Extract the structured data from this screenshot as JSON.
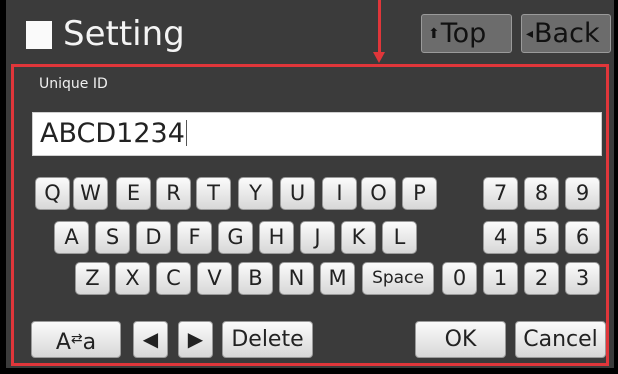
{
  "header": {
    "title": "Setting",
    "top_label": "Top",
    "top_icon": "⬆",
    "back_label": "Back",
    "back_icon": "◂"
  },
  "form": {
    "unique_id_label": "Unique ID",
    "unique_id_value": "ABCD1234"
  },
  "keyboard": {
    "letters_row1": [
      "Q",
      "W",
      "E",
      "R",
      "T",
      "Y",
      "U",
      "I",
      "O",
      "P"
    ],
    "letters_row2": [
      "A",
      "S",
      "D",
      "F",
      "G",
      "H",
      "J",
      "K",
      "L"
    ],
    "letters_row3": [
      "Z",
      "X",
      "C",
      "V",
      "B",
      "N",
      "M"
    ],
    "space_label": "Space",
    "numpad_row1": [
      "7",
      "8",
      "9"
    ],
    "numpad_row2": [
      "4",
      "5",
      "6"
    ],
    "numpad_row3": [
      "0",
      "1",
      "2",
      "3"
    ]
  },
  "bottom": {
    "case_toggle_left": "A",
    "case_toggle_mid": "⇄",
    "case_toggle_right": "a",
    "left_arrow": "◀",
    "right_arrow": "▶",
    "delete_label": "Delete",
    "ok_label": "OK",
    "cancel_label": "Cancel"
  },
  "colors": {
    "highlight": "#e0363a",
    "panel": "#3b3b3b"
  },
  "icons": [
    "checkbox-square-icon",
    "up-arrow-icon",
    "back-triangle-icon",
    "swap-arrows-icon",
    "left-arrow-icon",
    "right-arrow-icon",
    "annotation-arrow-icon"
  ]
}
